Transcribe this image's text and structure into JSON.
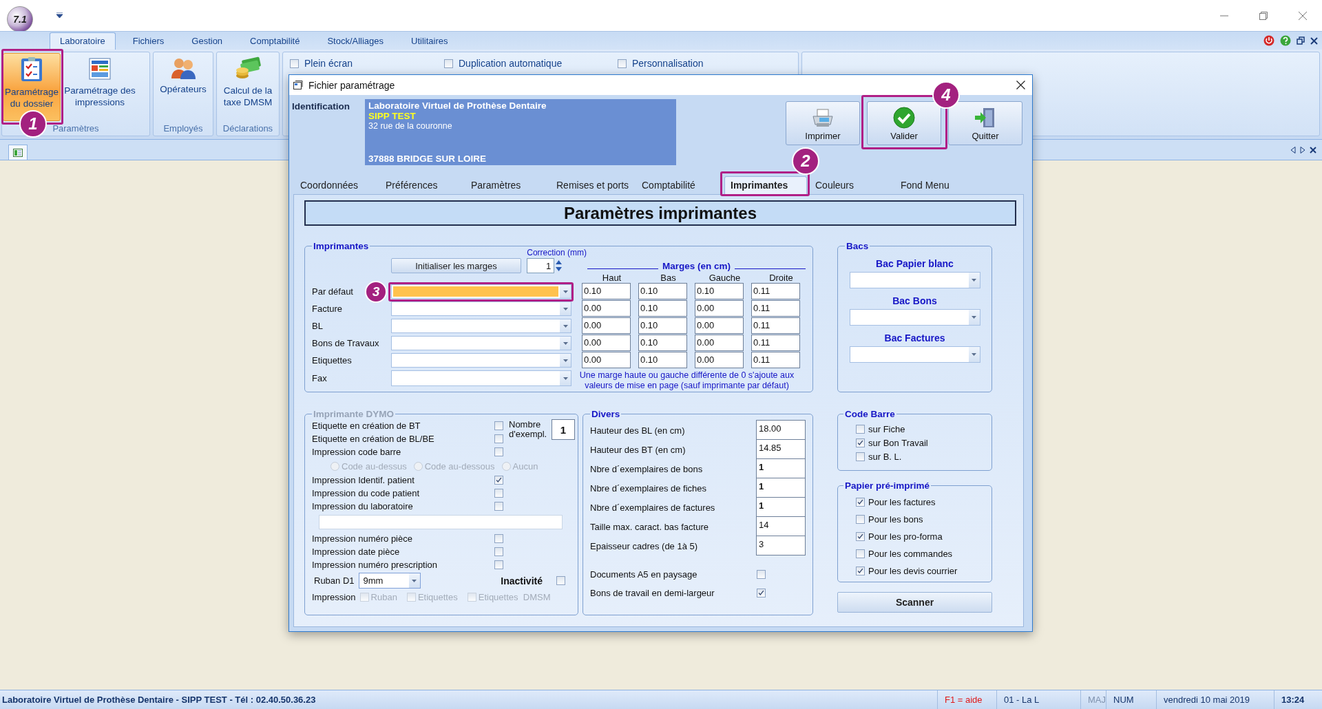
{
  "app": {
    "logo": "7.1"
  },
  "ribbon": {
    "tabs": [
      {
        "label": "Laboratoire",
        "selected": true
      },
      {
        "label": "Fichiers",
        "selected": false
      },
      {
        "label": "Gestion",
        "selected": false
      },
      {
        "label": "Comptabilité",
        "selected": false
      },
      {
        "label": "Stock/Alliages",
        "selected": false
      },
      {
        "label": "Utilitaires",
        "selected": false
      }
    ],
    "groups": [
      {
        "label": "Paramètres",
        "buttons": [
          {
            "label": "Paramétrage du dossier",
            "selected": true
          },
          {
            "label": "Paramétrage des impressions",
            "selected": false
          }
        ]
      },
      {
        "label": "Employés",
        "buttons": [
          {
            "label": "Opérateurs",
            "selected": false
          }
        ]
      },
      {
        "label": "Déclarations",
        "buttons": [
          {
            "label": "Calcul de la taxe DMSM",
            "selected": false
          }
        ]
      }
    ],
    "options": [
      {
        "label": "Plein écran",
        "checked": false
      },
      {
        "label": "Duplication automatique",
        "checked": false
      },
      {
        "label": "Personnalisation",
        "checked": false
      }
    ]
  },
  "dialog": {
    "title": "Fichier paramétrage",
    "identification": {
      "label": "Identification",
      "lines": [
        {
          "kind": "name",
          "text": "Laboratoire Virtuel de Prothèse Dentaire"
        },
        {
          "kind": "code",
          "text": "SIPP TEST"
        },
        {
          "kind": "address",
          "text": "32 rue de la couronne"
        },
        {
          "kind": "city",
          "text": "37888 BRIDGE SUR LOIRE"
        }
      ]
    },
    "actions": [
      {
        "label": "Imprimer"
      },
      {
        "label": "Valider"
      },
      {
        "label": "Quitter"
      }
    ],
    "tabs": [
      {
        "label": "Coordonnées",
        "selected": false
      },
      {
        "label": "Préférences",
        "selected": false
      },
      {
        "label": "Paramètres",
        "selected": false
      },
      {
        "label": "Remises et ports",
        "selected": false
      },
      {
        "label": "Comptabilité",
        "selected": false
      },
      {
        "label": "Imprimantes",
        "selected": true
      },
      {
        "label": "Couleurs",
        "selected": false
      },
      {
        "label": "Fond Menu",
        "selected": false
      }
    ],
    "section_title": "Paramètres imprimantes",
    "printers": {
      "legend": "Imprimantes",
      "reset_button": "Initialiser les marges",
      "correction": {
        "label": "Correction (mm)",
        "value": "1"
      },
      "margins_title": "Marges (en cm)",
      "columns": [
        "Haut",
        "Bas",
        "Gauche",
        "Droite"
      ],
      "rows": [
        {
          "label": "Par défaut",
          "selected": true,
          "margins": [
            "0.10",
            "0.10",
            "0.10",
            "0.11"
          ]
        },
        {
          "label": "Facture",
          "selected": false,
          "margins": [
            "0.00",
            "0.10",
            "0.00",
            "0.11"
          ]
        },
        {
          "label": "BL",
          "selected": false,
          "margins": [
            "0.00",
            "0.10",
            "0.00",
            "0.11"
          ]
        },
        {
          "label": "Bons de Travaux",
          "selected": false,
          "margins": [
            "0.00",
            "0.10",
            "0.00",
            "0.11"
          ]
        },
        {
          "label": "Etiquettes",
          "selected": false,
          "margins": [
            "0.00",
            "0.10",
            "0.00",
            "0.11"
          ]
        },
        {
          "label": "Fax",
          "selected": false
        }
      ],
      "note": "Une marge haute ou gauche différente de 0 s'ajoute aux valeurs de mise en page (sauf imprimante par défaut)"
    },
    "trays": {
      "legend": "Bacs",
      "items": [
        {
          "label": "Bac Papier blanc"
        },
        {
          "label": "Bac Bons"
        },
        {
          "label": "Bac Factures"
        }
      ]
    },
    "dymo": {
      "legend": "Imprimante DYMO",
      "options": [
        {
          "label": "Etiquette en création de BT",
          "checked": false
        },
        {
          "label": "Etiquette en création de BL/BE",
          "checked": false
        },
        {
          "label": "Impression code barre",
          "checked": false
        }
      ],
      "copies": {
        "label": "Nombre d'exempl.",
        "value": "1"
      },
      "barcode_positions": [
        {
          "label": "Code au-dessus",
          "selected": false
        },
        {
          "label": "Code au-dessous",
          "selected": false
        },
        {
          "label": "Aucun",
          "selected": false
        }
      ],
      "patient_options": [
        {
          "label": "Impression Identif. patient",
          "checked": true
        },
        {
          "label": "Impression du code patient",
          "checked": false
        },
        {
          "label": "Impression du laboratoire",
          "checked": false
        }
      ],
      "piece_options": [
        {
          "label": "Impression numéro pièce",
          "checked": false
        },
        {
          "label": "Impression date pièce",
          "checked": false
        },
        {
          "label": "Impression numéro prescription",
          "checked": false
        }
      ],
      "ribbon": {
        "label": "Ruban D1",
        "value": "9mm"
      },
      "inactivity": {
        "label": "Inactivité",
        "checked": false
      },
      "print": {
        "label": "Impression",
        "options": [
          {
            "label": "Ruban",
            "checked": false
          },
          {
            "label": "Etiquettes",
            "checked": false
          },
          {
            "label": "Etiquettes  DMSM",
            "checked": false
          }
        ]
      }
    },
    "misc": {
      "legend": "Divers",
      "fields": [
        {
          "label": "Hauteur des BL (en cm)",
          "value": "18.00",
          "bold": false
        },
        {
          "label": "Hauteur des BT (en cm)",
          "value": "14.85",
          "bold": false
        },
        {
          "label": "Nbre d´exemplaires de bons",
          "value": "1",
          "bold": true
        },
        {
          "label": "Nbre d´exemplaires de fiches",
          "value": "1",
          "bold": true
        },
        {
          "label": "Nbre d´exemplaires de factures",
          "value": "1",
          "bold": true
        },
        {
          "label": "Taille max. caract. bas facture",
          "value": "14",
          "bold": false
        },
        {
          "label": "Epaisseur cadres (de 1à 5)",
          "value": "3",
          "bold": false
        }
      ],
      "checks": [
        {
          "label": "Documents A5 en paysage",
          "checked": false
        },
        {
          "label": "Bons de travail en demi-largeur",
          "checked": true
        }
      ]
    },
    "barcode": {
      "legend": "Code Barre",
      "items": [
        {
          "label": "sur Fiche",
          "checked": false
        },
        {
          "label": "sur Bon Travail",
          "checked": true
        },
        {
          "label": "sur B. L.",
          "checked": false
        }
      ]
    },
    "preprinted": {
      "legend": "Papier pré-imprimé",
      "items": [
        {
          "label": "Pour les factures",
          "checked": true
        },
        {
          "label": "Pour les bons",
          "checked": false
        },
        {
          "label": "Pour les pro-forma",
          "checked": true
        },
        {
          "label": "Pour les commandes",
          "checked": false
        },
        {
          "label": "Pour les devis courrier",
          "checked": true
        }
      ]
    },
    "scan_button": "Scanner"
  },
  "callouts": [
    "1",
    "2",
    "3",
    "4"
  ],
  "status_bar": {
    "text": "Laboratoire Virtuel de Prothèse Dentaire - SIPP TEST - Tél : 02.40.50.36.23",
    "cells": [
      {
        "kind": "help",
        "text": "F1 = aide"
      },
      {
        "kind": "plain",
        "text": "01 - La L"
      },
      {
        "kind": "off",
        "text": "MAJ"
      },
      {
        "kind": "plain",
        "text": "NUM"
      },
      {
        "kind": "plain",
        "text": "vendredi 10 mai 2019"
      },
      {
        "kind": "bold",
        "text": "13:24"
      }
    ]
  }
}
